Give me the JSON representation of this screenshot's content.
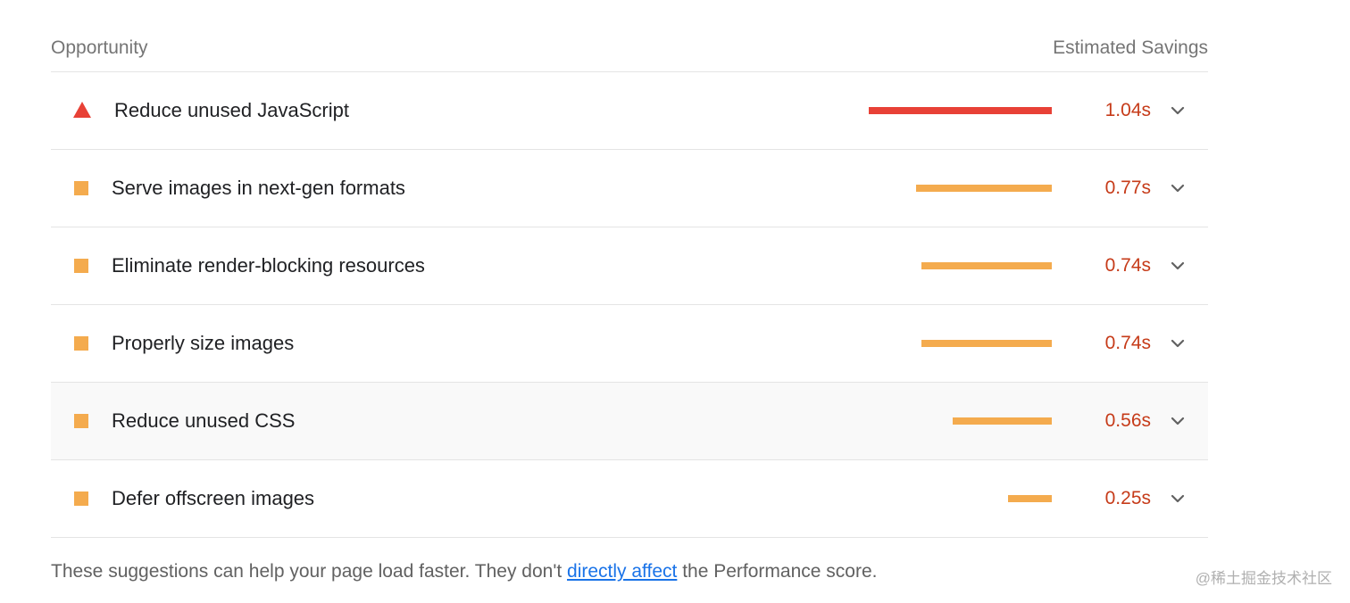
{
  "header": {
    "opportunity_label": "Opportunity",
    "savings_label": "Estimated Savings"
  },
  "opportunities": [
    {
      "title": "Reduce unused JavaScript",
      "savings": "1.04s",
      "rating": "fail",
      "bar_fraction": 1.0,
      "icon": "red-triangle-icon"
    },
    {
      "title": "Serve images in next-gen formats",
      "savings": "0.77s",
      "rating": "average",
      "bar_fraction": 0.74,
      "icon": "orange-square-icon"
    },
    {
      "title": "Eliminate render-blocking resources",
      "savings": "0.74s",
      "rating": "average",
      "bar_fraction": 0.71,
      "icon": "orange-square-icon"
    },
    {
      "title": "Properly size images",
      "savings": "0.74s",
      "rating": "average",
      "bar_fraction": 0.71,
      "icon": "orange-square-icon"
    },
    {
      "title": "Reduce unused CSS",
      "savings": "0.56s",
      "rating": "average",
      "bar_fraction": 0.54,
      "icon": "orange-square-icon"
    },
    {
      "title": "Defer offscreen images",
      "savings": "0.25s",
      "rating": "average",
      "bar_fraction": 0.24,
      "icon": "orange-square-icon"
    }
  ],
  "footer": {
    "text_before": "These suggestions can help your page load faster. They don't ",
    "link_text": "directly affect",
    "text_after": " the Performance score."
  },
  "watermark": "@稀土掘金技术社区",
  "colors": {
    "fail": "#e84136",
    "average": "#f4ab4e",
    "savings_text": "#c63b19",
    "link": "#1a73e8"
  }
}
